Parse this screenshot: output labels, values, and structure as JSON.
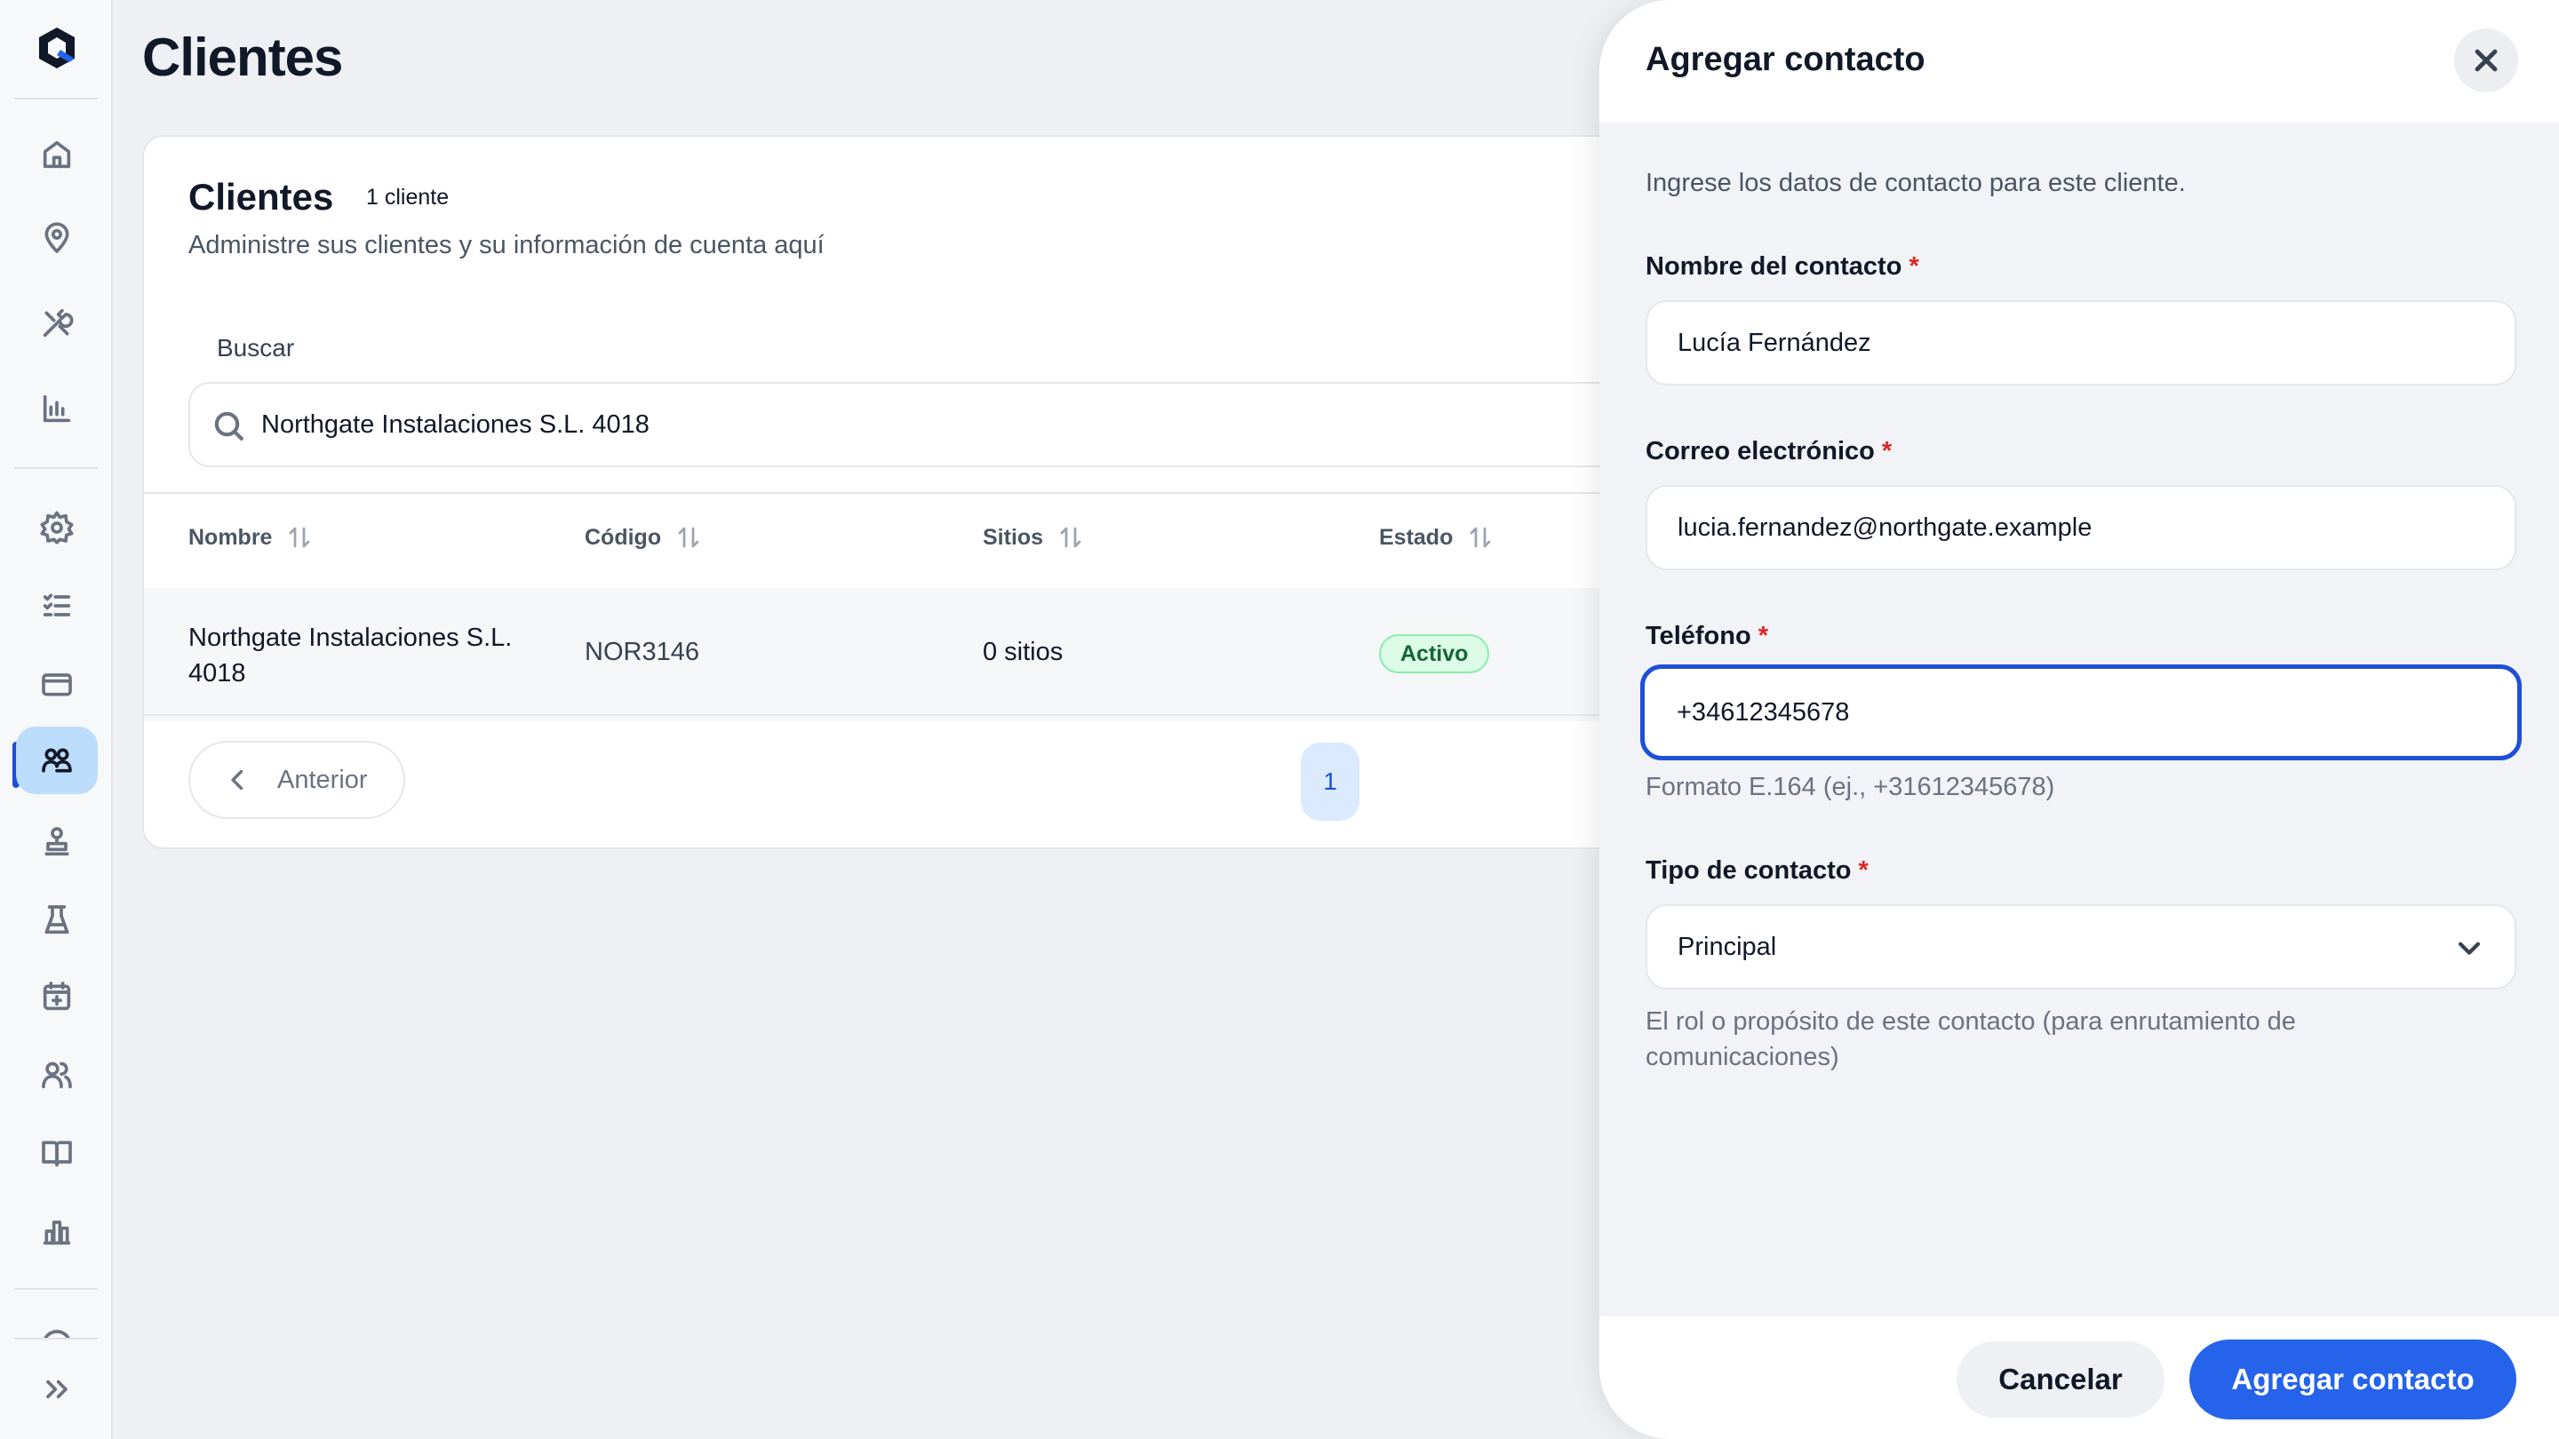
{
  "page": {
    "title": "Clientes"
  },
  "card": {
    "title": "Clientes",
    "count": "1 cliente",
    "subtitle": "Administre sus clientes y su información de cuenta aquí",
    "search_label": "Buscar",
    "search_value": "Northgate Instalaciones S.L. 4018"
  },
  "table": {
    "headers": [
      "Nombre",
      "Código",
      "Sitios",
      "Estado"
    ],
    "rows": [
      {
        "name": "Northgate Instalaciones S.L. 4018",
        "code": "NOR3146",
        "sites": "0 sitios",
        "status": "Activo"
      }
    ]
  },
  "pagination": {
    "prev_label": "Anterior",
    "current_page": "1"
  },
  "drawer": {
    "title": "Agregar contacto",
    "intro": "Ingrese los datos de contacto para este cliente.",
    "fields": {
      "name": {
        "label": "Nombre del contacto",
        "value": "Lucía Fernández"
      },
      "email": {
        "label": "Correo electrónico",
        "value": "lucia.fernandez@northgate.example"
      },
      "phone": {
        "label": "Teléfono",
        "value": "+34612345678",
        "hint": "Formato E.164 (ej., +31612345678)"
      },
      "type": {
        "label": "Tipo de contacto",
        "value": "Principal",
        "hint": "El rol o propósito de este contacto (para enrutamiento de comunicaciones)"
      }
    },
    "required_mark": "*",
    "cancel_label": "Cancelar",
    "submit_label": "Agregar contacto"
  },
  "colors": {
    "accent": "#2563eb",
    "active_nav": "#bcdcfb",
    "status_bg": "#dcfce7",
    "status_text": "#166534",
    "required": "#dc2626"
  },
  "sidebar": {
    "icons": [
      "home-icon",
      "map-pin-icon",
      "tools-icon",
      "bar-chart-icon",
      "gear-icon",
      "checklist-icon",
      "credit-card-icon",
      "clients-icon",
      "stamp-icon",
      "flask-icon",
      "calendar-icon",
      "users-icon",
      "book-icon",
      "analytics-icon",
      "help-icon",
      "expand-icon"
    ],
    "active": "clients-icon"
  }
}
